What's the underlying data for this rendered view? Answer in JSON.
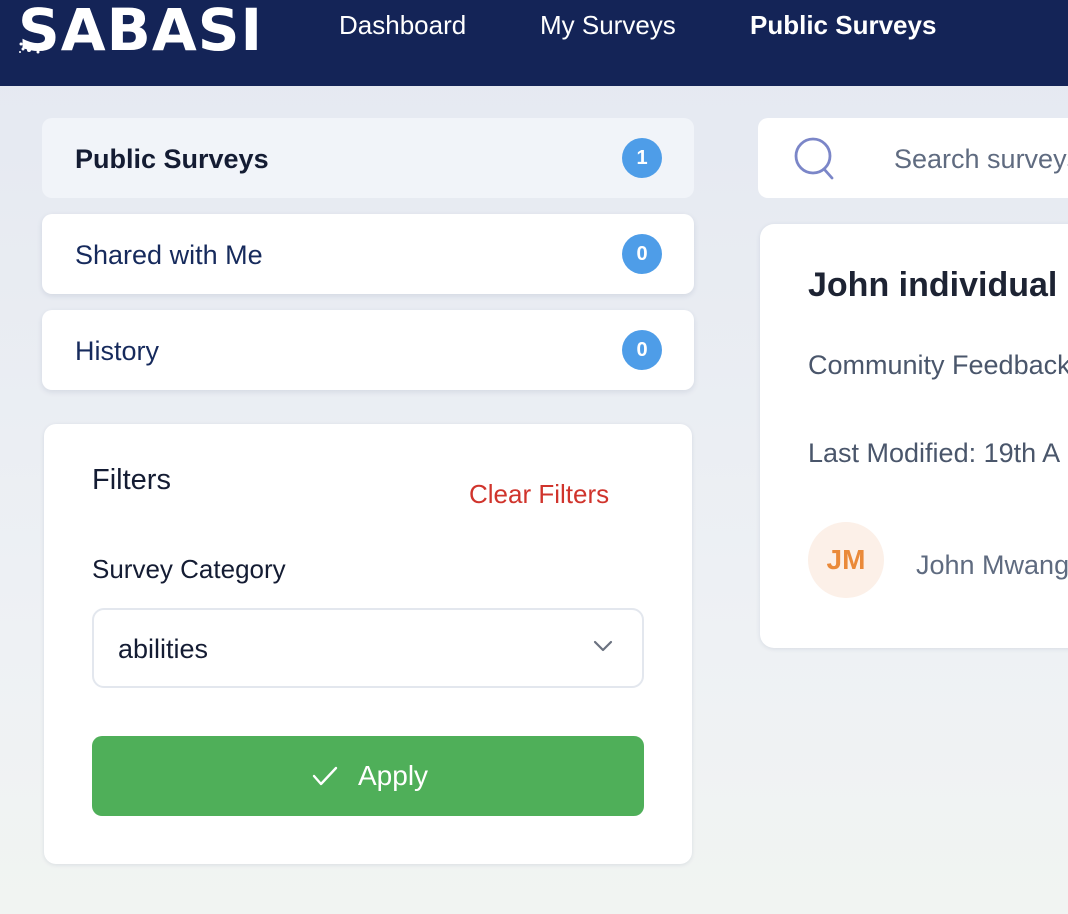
{
  "header": {
    "logo": "SABASI",
    "nav": [
      {
        "label": "Dashboard",
        "active": false
      },
      {
        "label": "My Surveys",
        "active": false
      },
      {
        "label": "Public Surveys",
        "active": true
      }
    ]
  },
  "sidebar": {
    "items": [
      {
        "label": "Public Surveys",
        "count": "1",
        "active": true
      },
      {
        "label": "Shared with Me",
        "count": "0",
        "active": false
      },
      {
        "label": "History",
        "count": "0",
        "active": false
      }
    ]
  },
  "filters": {
    "title": "Filters",
    "clear_label": "Clear Filters",
    "category_label": "Survey Category",
    "category_value": "abilities",
    "apply_label": "Apply"
  },
  "search": {
    "placeholder": "Search surveys"
  },
  "survey_card": {
    "title": "John individual",
    "category": "Community Feedback",
    "last_modified": "Last Modified: 19th A",
    "author_initials": "JM",
    "author_name": "John Mwangi"
  },
  "colors": {
    "header_bg": "#142457",
    "badge": "#4e9de8",
    "apply": "#4faf59",
    "clear_filters": "#d0342c",
    "avatar_text": "#ea8a3a"
  }
}
